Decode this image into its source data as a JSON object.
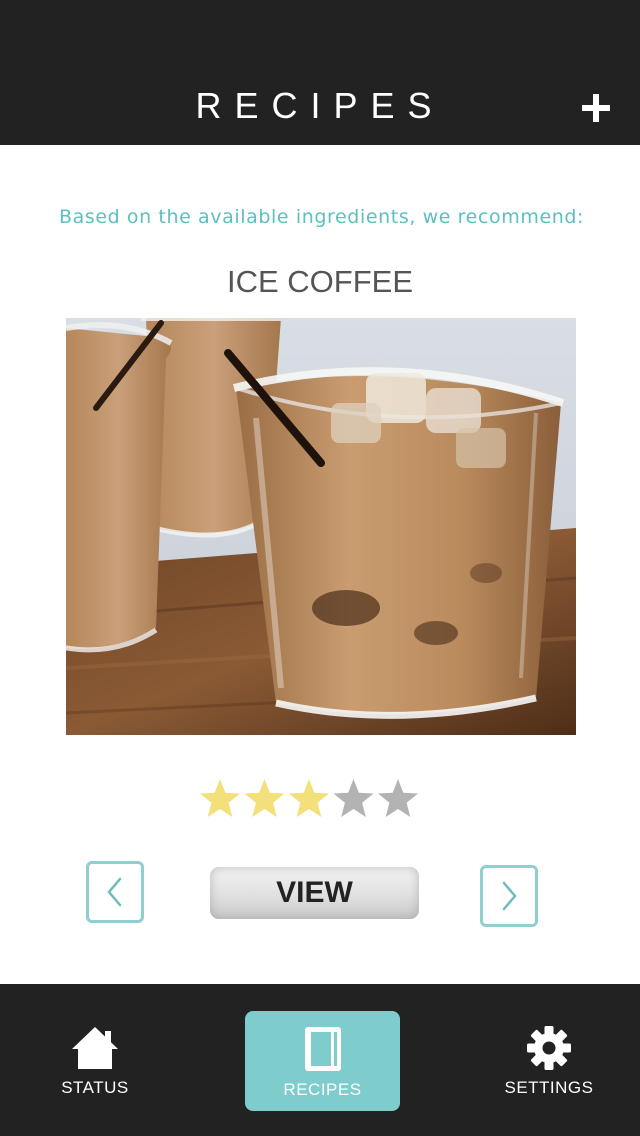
{
  "header": {
    "title": "RECIPES",
    "add_icon": "plus-icon"
  },
  "recommendation": {
    "intro": "Based on the available ingredients, we recommend:",
    "recipe_name": "ICE COFFEE",
    "photo_alt": "ice-coffee-photo",
    "rating": 3,
    "rating_max": 5,
    "star_color_filled": "#f3e07a",
    "star_color_empty": "#b3b3b3"
  },
  "controls": {
    "prev_icon": "chevron-left-icon",
    "view_label": "VIEW",
    "next_icon": "chevron-right-icon"
  },
  "tabbar": {
    "tabs": [
      {
        "label": "STATUS",
        "icon": "home-icon",
        "active": false
      },
      {
        "label": "RECIPES",
        "icon": "book-icon",
        "active": true
      },
      {
        "label": "SETTINGS",
        "icon": "gear-icon",
        "active": false
      }
    ]
  },
  "colors": {
    "bar_background": "#222222",
    "accent": "#7ecccc",
    "intro_text": "#5cc0c0"
  }
}
